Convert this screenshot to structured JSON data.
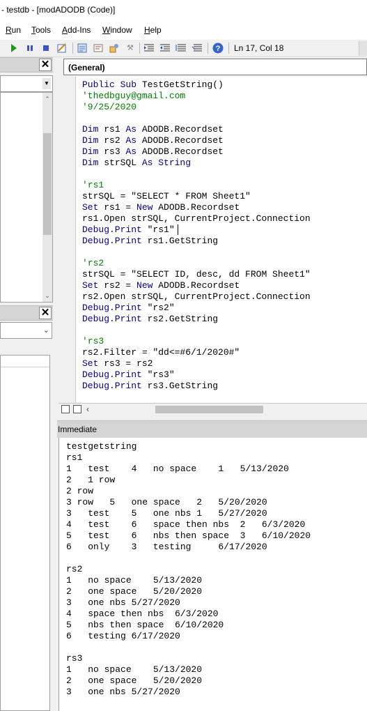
{
  "window": {
    "title": "- testdb - [modADODB (Code)]"
  },
  "menu": [
    {
      "label": "Run",
      "key": "R",
      "rest": "un"
    },
    {
      "label": "Tools",
      "key": "T",
      "rest": "ools"
    },
    {
      "label": "Add-Ins",
      "key": "A",
      "rest": "dd-Ins"
    },
    {
      "label": "Window",
      "key": "W",
      "rest": "indow"
    },
    {
      "label": "Help",
      "key": "H",
      "rest": "elp"
    }
  ],
  "toolbar": {
    "run_icon": "play-icon",
    "break_icon": "pause-icon",
    "reset_icon": "stop-icon",
    "position": "Ln 17, Col 18"
  },
  "code_window": {
    "procedure_combo": "(General)",
    "lines": [
      {
        "parts": [
          {
            "t": "Public Sub ",
            "c": "kw"
          },
          {
            "t": "TestGetString()",
            "c": ""
          }
        ]
      },
      {
        "parts": [
          {
            "t": "'thedbguy@gmail.com",
            "c": "cm"
          }
        ]
      },
      {
        "parts": [
          {
            "t": "'9/25/2020",
            "c": "cm"
          }
        ]
      },
      {
        "parts": []
      },
      {
        "parts": [
          {
            "t": "Dim ",
            "c": "kw"
          },
          {
            "t": "rs1 ",
            "c": ""
          },
          {
            "t": "As ",
            "c": "kw"
          },
          {
            "t": "ADODB.Recordset",
            "c": ""
          }
        ]
      },
      {
        "parts": [
          {
            "t": "Dim ",
            "c": "kw"
          },
          {
            "t": "rs2 ",
            "c": ""
          },
          {
            "t": "As ",
            "c": "kw"
          },
          {
            "t": "ADODB.Recordset",
            "c": ""
          }
        ]
      },
      {
        "parts": [
          {
            "t": "Dim ",
            "c": "kw"
          },
          {
            "t": "rs3 ",
            "c": ""
          },
          {
            "t": "As ",
            "c": "kw"
          },
          {
            "t": "ADODB.Recordset",
            "c": ""
          }
        ]
      },
      {
        "parts": [
          {
            "t": "Dim ",
            "c": "kw"
          },
          {
            "t": "strSQL ",
            "c": ""
          },
          {
            "t": "As String",
            "c": "kw"
          }
        ]
      },
      {
        "parts": []
      },
      {
        "parts": [
          {
            "t": "'rs1",
            "c": "cm"
          }
        ]
      },
      {
        "parts": [
          {
            "t": "strSQL = \"SELECT * FROM Sheet1\"",
            "c": ""
          }
        ]
      },
      {
        "parts": [
          {
            "t": "Set ",
            "c": "kw"
          },
          {
            "t": "rs1 = ",
            "c": ""
          },
          {
            "t": "New ",
            "c": "kw"
          },
          {
            "t": "ADODB.Recordset",
            "c": ""
          }
        ]
      },
      {
        "parts": [
          {
            "t": "rs1.Open strSQL, CurrentProject.Connection",
            "c": ""
          }
        ]
      },
      {
        "parts": [
          {
            "t": "Debug.Print ",
            "c": "kw"
          },
          {
            "t": "\"rs1\"",
            "c": ""
          }
        ]
      },
      {
        "parts": [
          {
            "t": "Debug.Print ",
            "c": "kw"
          },
          {
            "t": "rs1.GetString",
            "c": ""
          }
        ]
      },
      {
        "parts": []
      },
      {
        "parts": [
          {
            "t": "'rs2",
            "c": "cm"
          }
        ]
      },
      {
        "parts": [
          {
            "t": "strSQL = \"SELECT ID, desc, dd FROM Sheet1\"",
            "c": ""
          }
        ]
      },
      {
        "parts": [
          {
            "t": "Set ",
            "c": "kw"
          },
          {
            "t": "rs2 = ",
            "c": ""
          },
          {
            "t": "New ",
            "c": "kw"
          },
          {
            "t": "ADODB.Recordset",
            "c": ""
          }
        ]
      },
      {
        "parts": [
          {
            "t": "rs2.Open strSQL, CurrentProject.Connection",
            "c": ""
          }
        ]
      },
      {
        "parts": [
          {
            "t": "Debug.Print ",
            "c": "kw"
          },
          {
            "t": "\"rs2\"",
            "c": ""
          }
        ]
      },
      {
        "parts": [
          {
            "t": "Debug.Print ",
            "c": "kw"
          },
          {
            "t": "rs2.GetString",
            "c": ""
          }
        ]
      },
      {
        "parts": []
      },
      {
        "parts": [
          {
            "t": "'rs3",
            "c": "cm"
          }
        ]
      },
      {
        "parts": [
          {
            "t": "rs2.Filter = \"dd<=#6/1/2020#\"",
            "c": ""
          }
        ]
      },
      {
        "parts": [
          {
            "t": "Set ",
            "c": "kw"
          },
          {
            "t": "rs3 = rs2",
            "c": ""
          }
        ]
      },
      {
        "parts": [
          {
            "t": "Debug.Print ",
            "c": "kw"
          },
          {
            "t": "\"rs3\"",
            "c": ""
          }
        ]
      },
      {
        "parts": [
          {
            "t": "Debug.Print ",
            "c": "kw"
          },
          {
            "t": "rs3.GetString",
            "c": ""
          }
        ]
      }
    ]
  },
  "immediate": {
    "title": "Immediate",
    "lines": [
      "testgetstring",
      "rs1",
      "1   test    4   no space    1   5/13/2020",
      "2   1 row",
      "2 row",
      "3 row   5   one space   2   5/20/2020",
      "3   test    5   one nbs 1   5/27/2020",
      "4   test    6   space then nbs  2   6/3/2020",
      "5   test    6   nbs then space  3   6/10/2020",
      "6   only    3   testing     6/17/2020",
      "",
      "rs2",
      "1   no space    5/13/2020",
      "2   one space   5/20/2020",
      "3   one nbs 5/27/2020",
      "4   space then nbs  6/3/2020",
      "5   nbs then space  6/10/2020",
      "6   testing 6/17/2020",
      "",
      "rs3",
      "1   no space    5/13/2020",
      "2   one space   5/20/2020",
      "3   one nbs 5/27/2020"
    ]
  },
  "colors": {
    "keyword": "#00008b",
    "comment": "#008000"
  }
}
